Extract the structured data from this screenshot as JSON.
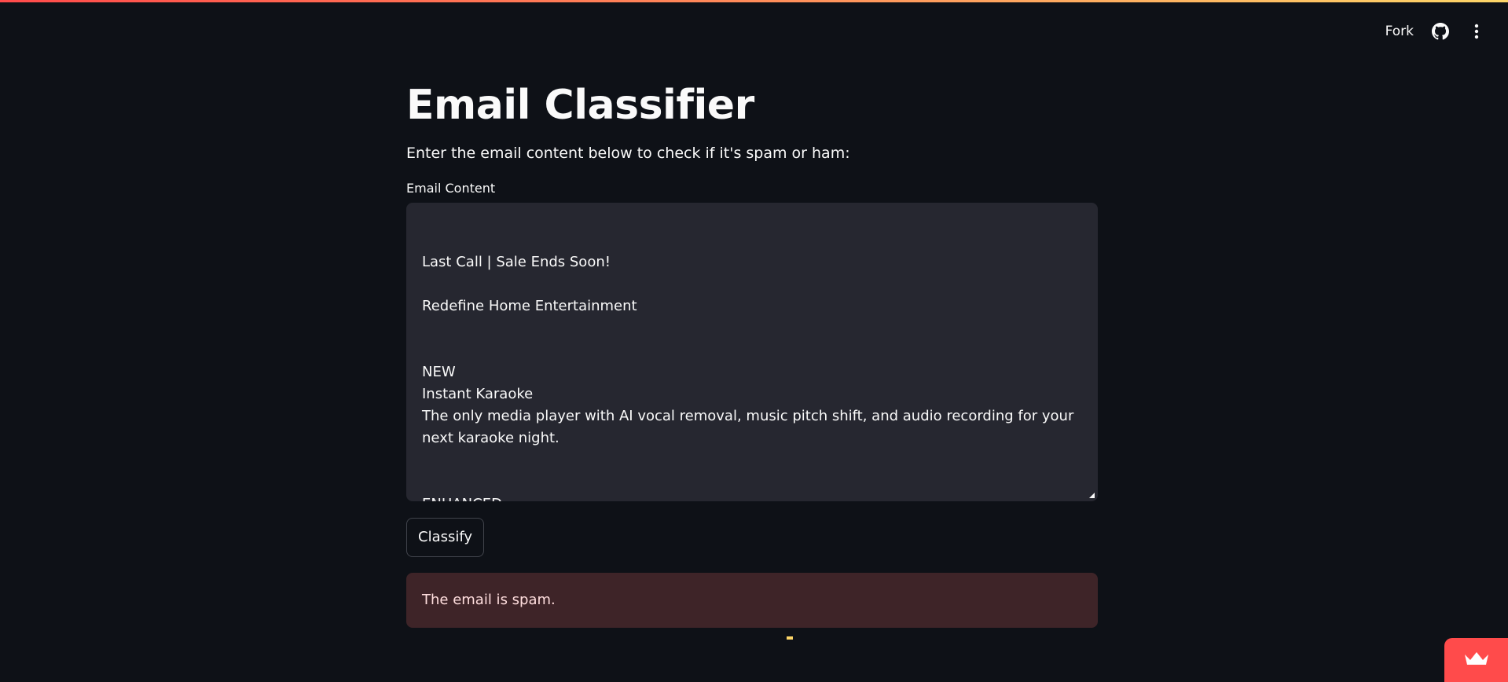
{
  "header": {
    "fork_label": "Fork",
    "github_icon": "github-icon",
    "menu_icon": "more-vertical-icon"
  },
  "main": {
    "title": "Email Classifier",
    "subtitle": "Enter the email content below to check if it's spam or ham:",
    "field_label": "Email Content",
    "email_value": "\nLast Call | Sale Ends Soon!\n\nRedefine Home Entertainment\n\n\nNEW\nInstant Karaoke\nThe only media player with AI vocal removal, music pitch shift, and audio recording for your next karaoke night.\n\n\nENHANCED",
    "classify_label": "Classify",
    "result_text": "The email is spam."
  },
  "footer": {
    "badge_icon": "crown-icon"
  },
  "colors": {
    "background": "#0e1117",
    "input_bg": "#262730",
    "error_bg": "#3e2428",
    "accent": "#ff4b4b"
  }
}
